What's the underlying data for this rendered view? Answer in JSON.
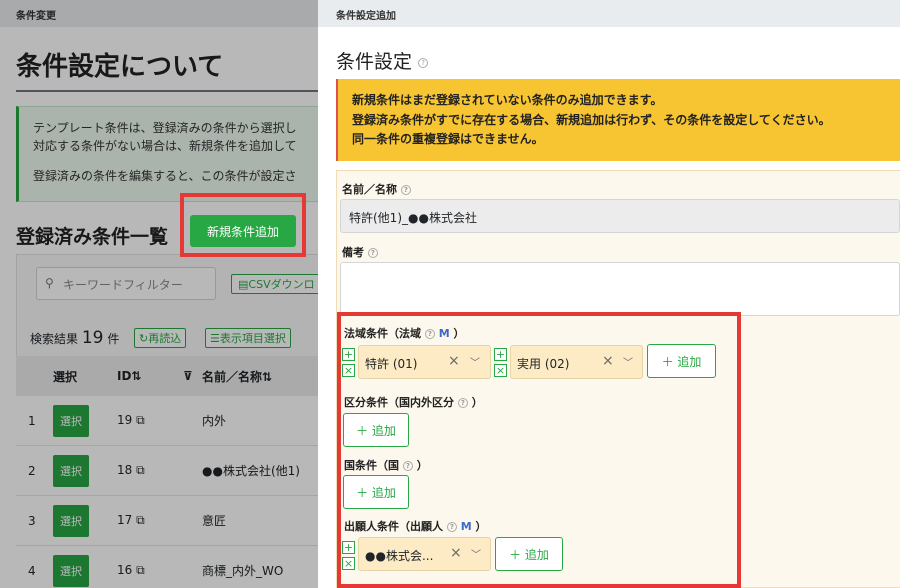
{
  "left": {
    "topbar": "条件変更",
    "page_title": "条件設定について",
    "info_line1": "テンプレート条件は、登録済みの条件から選択し",
    "info_line2": "対応する条件がない場合は、新規条件を追加して",
    "info_line3": "登録済みの条件を編集すると、この条件が設定さ",
    "list_title": "登録済み条件一覧",
    "new_condition_button": "新規条件追加",
    "keyword_placeholder": "キーワードフィルター",
    "csv_button": "CSVダウンロ",
    "results_label": "検索結果",
    "results_count": "19",
    "results_unit": "件",
    "reload_button": "再読込",
    "columns_button": "表示項目選択",
    "table": {
      "headers": {
        "select": "選択",
        "id": "ID⇅",
        "name": "名前／名称⇅"
      },
      "select_label": "選択",
      "rows": [
        {
          "num": "1",
          "id": "19",
          "name": "内外"
        },
        {
          "num": "2",
          "id": "18",
          "name": "●●株式会社(他1)"
        },
        {
          "num": "3",
          "id": "17",
          "name": "意匠"
        },
        {
          "num": "4",
          "id": "16",
          "name": "商標_内外_WO"
        }
      ]
    }
  },
  "right": {
    "topbar": "条件設定追加",
    "title": "条件設定",
    "warning_line1": "新規条件はまだ登録されていない条件のみ追加できます。",
    "warning_line2": "登録済み条件がすでに存在する場合、新規追加は行わず、その条件を設定してください。",
    "warning_line3": "同一条件の重複登録はできません。",
    "name_label": "名前／名称",
    "name_value": "特許(他1)_●●株式会社",
    "memo_label": "備考",
    "law_label": "法域条件（法域",
    "law_chips": [
      "特許 (01)",
      "実用 (02)"
    ],
    "add_label": "＋ 追加",
    "division_label": "区分条件（国内外区分",
    "country_label": "国条件（国",
    "applicant_label": "出願人条件（出願人",
    "applicant_chips": [
      "●●株式会..."
    ],
    "m_mark": "M",
    "close_paren": "）"
  }
}
